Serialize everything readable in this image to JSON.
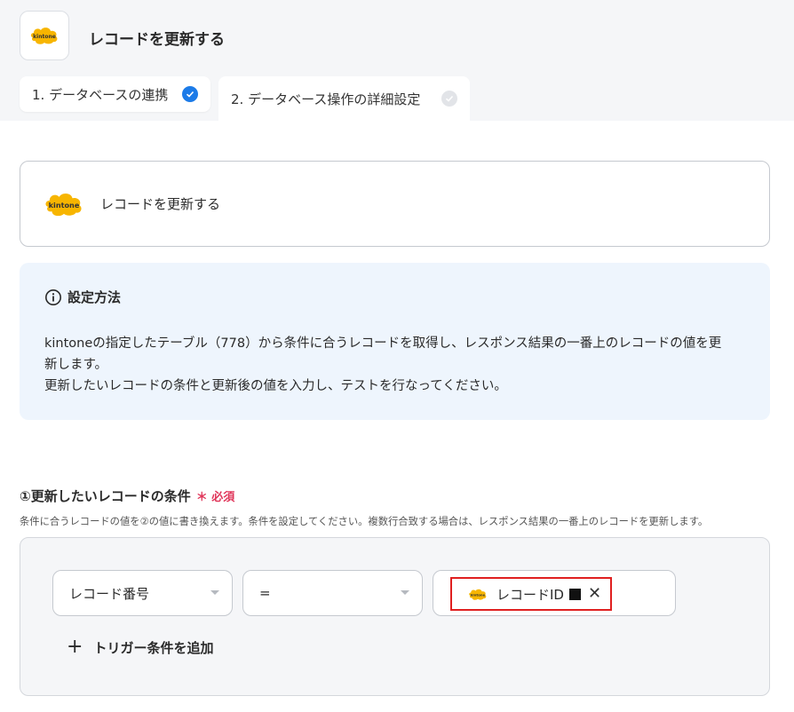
{
  "header": {
    "title": "レコードを更新する",
    "logo_text": "kintone",
    "logo_color": "#f7b500"
  },
  "tabs": [
    {
      "label": "1. データベースの連携",
      "status": "done"
    },
    {
      "label": "2. データベース操作の詳細設定",
      "status": "pending"
    }
  ],
  "action_card": {
    "label": "レコードを更新する",
    "logo_text": "kintone"
  },
  "info": {
    "heading": "設定方法",
    "line1": "kintoneの指定したテーブル（778）から条件に合うレコードを取得し、レスポンス結果の一番上のレコードの値を更",
    "line2": "新します。",
    "line3": "更新したいレコードの条件と更新後の値を入力し、テストを行なってください。"
  },
  "condition": {
    "title": "①更新したいレコードの条件",
    "required_label": "必須",
    "description": "条件に合うレコードの値を②の値に書き換えます。条件を設定してください。複数行合致する場合は、レスポンス結果の一番上のレコードを更新します。",
    "field_value": "レコード番号",
    "operator_value": "=",
    "chip_label": "レコードID",
    "chip_logo_text": "kintone",
    "add_label": "トリガー条件を追加"
  },
  "colors": {
    "accent_blue": "#1c7be8",
    "required_red": "#e0365a",
    "highlight_red": "#e02020",
    "info_bg": "#eef5fd"
  }
}
